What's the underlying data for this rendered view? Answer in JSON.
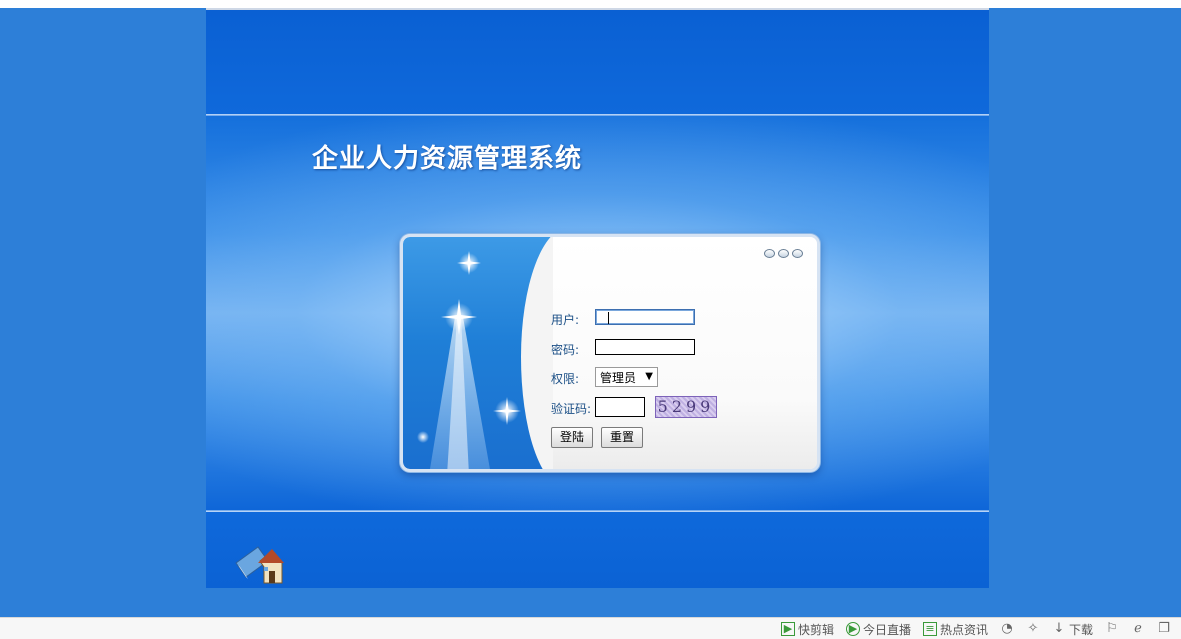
{
  "page": {
    "title": "企业人力资源管理系统"
  },
  "login_form": {
    "username_label": "用户:",
    "username_value": "",
    "password_label": "密码:",
    "password_value": "",
    "role_label": "权限:",
    "role_selected": "管理员",
    "captcha_label": "验证码:",
    "captcha_value": "",
    "captcha_code": "5299",
    "login_button": "登陆",
    "reset_button": "重置"
  },
  "browser_toolbar": {
    "items": [
      {
        "label": "快剪辑",
        "icon": "play-box-icon"
      },
      {
        "label": "今日直播",
        "icon": "play-circle-icon"
      },
      {
        "label": "热点资讯",
        "icon": "news-icon"
      },
      {
        "label": "",
        "icon": "speed-icon"
      },
      {
        "label": "",
        "icon": "pin-icon"
      },
      {
        "label": "下载",
        "icon": "download-icon"
      },
      {
        "label": "",
        "icon": "flag-icon"
      },
      {
        "label": "",
        "icon": "ie-icon"
      },
      {
        "label": "",
        "icon": "window-icon"
      }
    ]
  },
  "colors": {
    "outer_background": "#2d7fd8",
    "page_blue": "#0b64d6",
    "label_text": "#1b4f86",
    "title_text": "#ffffff"
  }
}
